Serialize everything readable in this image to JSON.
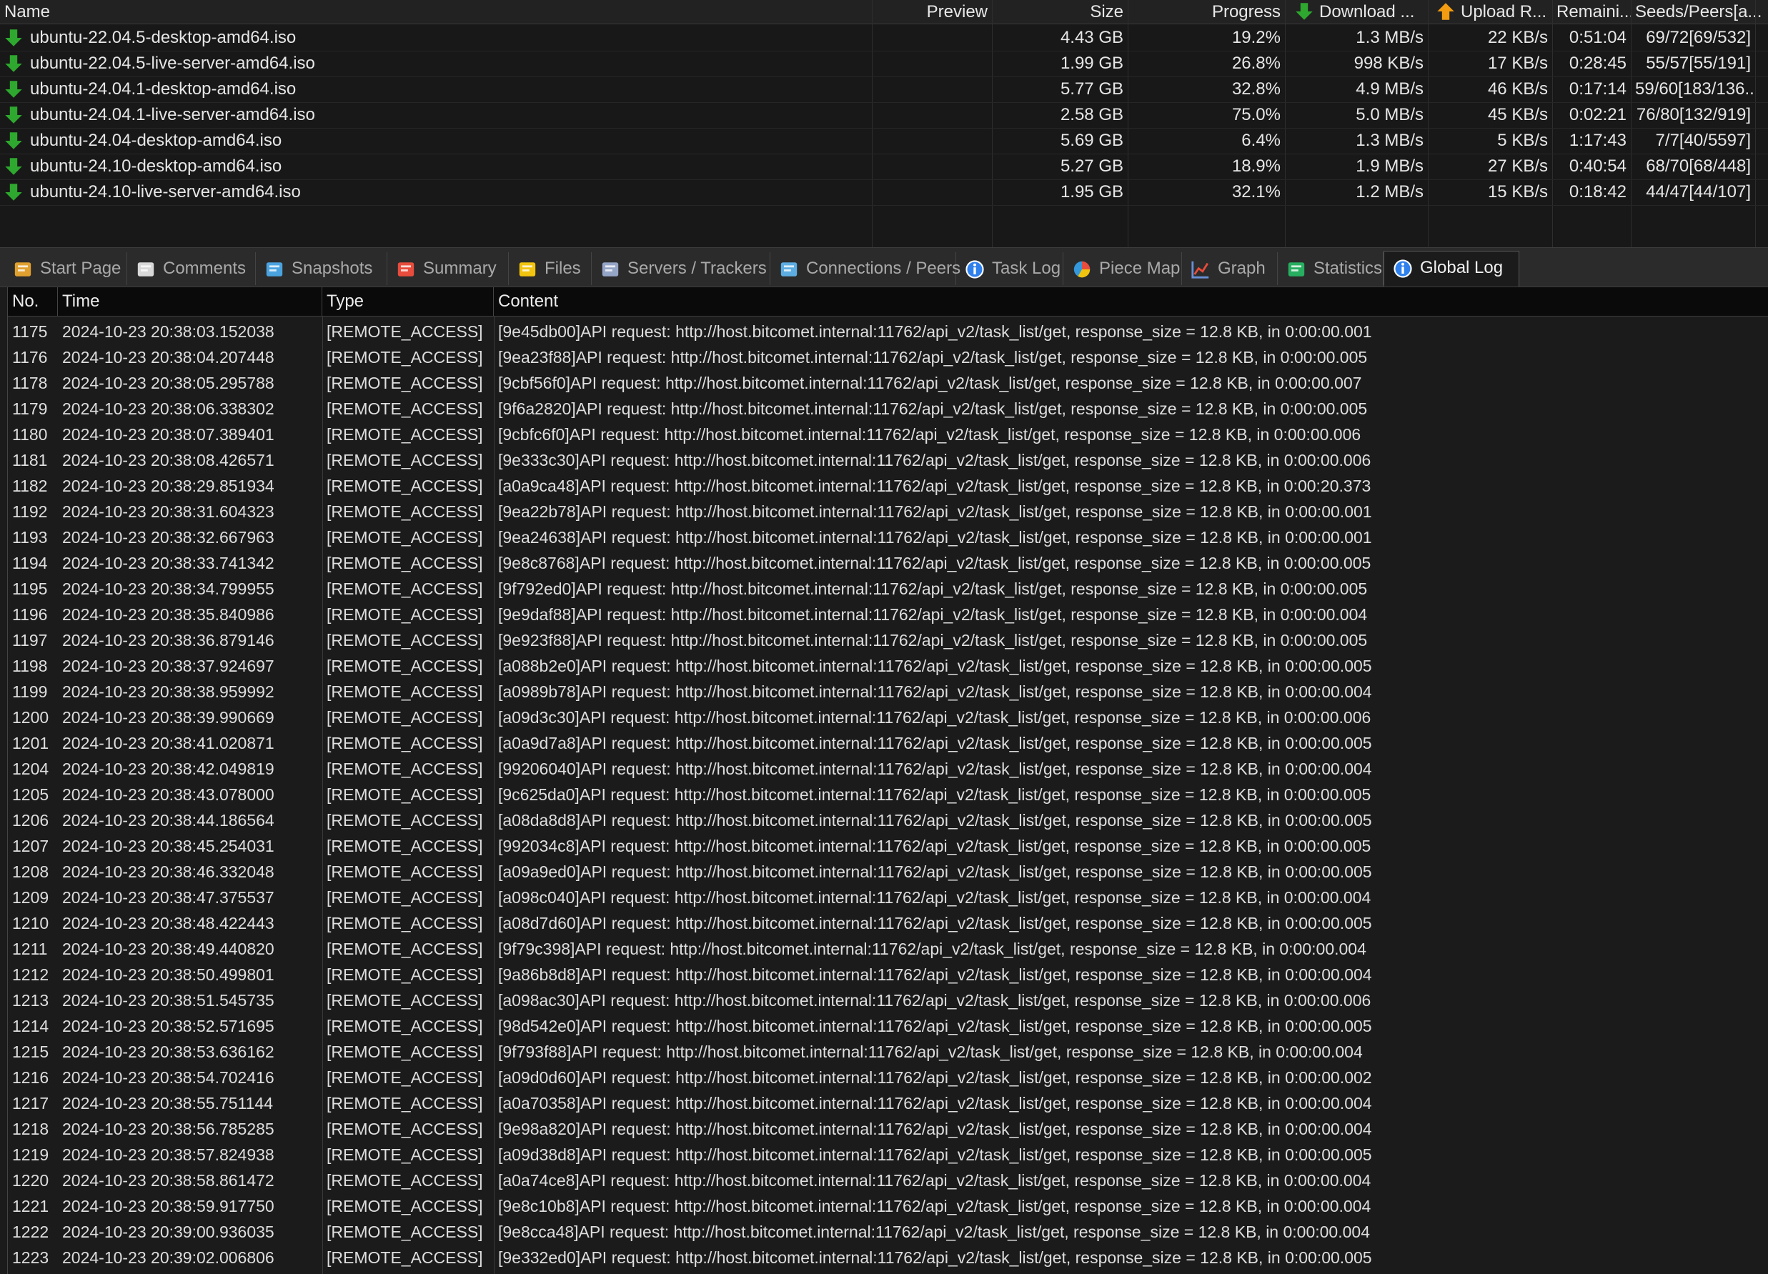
{
  "colors": {
    "accent_green": "#2ea82e",
    "upload_orange": "#f39c12",
    "bg": "#1b1b1b"
  },
  "tasks": {
    "columns": [
      "Name",
      "Preview",
      "Size",
      "Progress",
      "Download ...",
      "Upload R...",
      "Remaini...",
      "Seeds/Peers[a..."
    ],
    "rows": [
      {
        "name": "ubuntu-22.04.5-desktop-amd64.iso",
        "preview": "",
        "size": "4.43 GB",
        "progress": "19.2%",
        "download": "1.3 MB/s",
        "upload": "22 KB/s",
        "remaining": "0:51:04",
        "seeds": "69/72[69/532]"
      },
      {
        "name": "ubuntu-22.04.5-live-server-amd64.iso",
        "preview": "",
        "size": "1.99 GB",
        "progress": "26.8%",
        "download": "998 KB/s",
        "upload": "17 KB/s",
        "remaining": "0:28:45",
        "seeds": "55/57[55/191]"
      },
      {
        "name": "ubuntu-24.04.1-desktop-amd64.iso",
        "preview": "",
        "size": "5.77 GB",
        "progress": "32.8%",
        "download": "4.9 MB/s",
        "upload": "46 KB/s",
        "remaining": "0:17:14",
        "seeds": "59/60[183/136..."
      },
      {
        "name": "ubuntu-24.04.1-live-server-amd64.iso",
        "preview": "",
        "size": "2.58 GB",
        "progress": "75.0%",
        "download": "5.0 MB/s",
        "upload": "45 KB/s",
        "remaining": "0:02:21",
        "seeds": "76/80[132/919]"
      },
      {
        "name": "ubuntu-24.04-desktop-amd64.iso",
        "preview": "",
        "size": "5.69 GB",
        "progress": "6.4%",
        "download": "1.3 MB/s",
        "upload": "5 KB/s",
        "remaining": "1:17:43",
        "seeds": "7/7[40/5597]"
      },
      {
        "name": "ubuntu-24.10-desktop-amd64.iso",
        "preview": "",
        "size": "5.27 GB",
        "progress": "18.9%",
        "download": "1.9 MB/s",
        "upload": "27 KB/s",
        "remaining": "0:40:54",
        "seeds": "68/70[68/448]"
      },
      {
        "name": "ubuntu-24.10-live-server-amd64.iso",
        "preview": "",
        "size": "1.95 GB",
        "progress": "32.1%",
        "download": "1.2 MB/s",
        "upload": "15 KB/s",
        "remaining": "0:18:42",
        "seeds": "44/47[44/107]"
      }
    ]
  },
  "tabs": [
    {
      "label": "Start Page",
      "icon": "start-page-icon"
    },
    {
      "label": "Comments",
      "icon": "comments-icon"
    },
    {
      "label": "Snapshots",
      "icon": "snapshots-icon"
    },
    {
      "label": "Summary",
      "icon": "summary-icon"
    },
    {
      "label": "Files",
      "icon": "files-icon"
    },
    {
      "label": "Servers / Trackers",
      "icon": "servers-icon"
    },
    {
      "label": "Connections / Peers",
      "icon": "peers-icon"
    },
    {
      "label": "Task Log",
      "icon": "info-icon"
    },
    {
      "label": "Piece Map",
      "icon": "piece-map-icon"
    },
    {
      "label": "Graph",
      "icon": "graph-icon"
    },
    {
      "label": "Statistics",
      "icon": "statistics-icon"
    },
    {
      "label": "Global Log",
      "icon": "info-icon",
      "active": true
    }
  ],
  "log": {
    "columns": [
      "No.",
      "Time",
      "Type",
      "Content"
    ],
    "rows": [
      {
        "no": "1175",
        "time": "2024-10-23 20:38:03.152038",
        "type": "[REMOTE_ACCESS]",
        "content": "[9e45db00]API request: http://host.bitcomet.internal:11762/api_v2/task_list/get, response_size = 12.8 KB, in 0:00:00.001"
      },
      {
        "no": "1176",
        "time": "2024-10-23 20:38:04.207448",
        "type": "[REMOTE_ACCESS]",
        "content": "[9ea23f88]API request: http://host.bitcomet.internal:11762/api_v2/task_list/get, response_size = 12.8 KB, in 0:00:00.005"
      },
      {
        "no": "1178",
        "time": "2024-10-23 20:38:05.295788",
        "type": "[REMOTE_ACCESS]",
        "content": "[9cbf56f0]API request: http://host.bitcomet.internal:11762/api_v2/task_list/get, response_size = 12.8 KB, in 0:00:00.007"
      },
      {
        "no": "1179",
        "time": "2024-10-23 20:38:06.338302",
        "type": "[REMOTE_ACCESS]",
        "content": "[9f6a2820]API request: http://host.bitcomet.internal:11762/api_v2/task_list/get, response_size = 12.8 KB, in 0:00:00.005"
      },
      {
        "no": "1180",
        "time": "2024-10-23 20:38:07.389401",
        "type": "[REMOTE_ACCESS]",
        "content": "[9cbfc6f0]API request: http://host.bitcomet.internal:11762/api_v2/task_list/get, response_size = 12.8 KB, in 0:00:00.006"
      },
      {
        "no": "1181",
        "time": "2024-10-23 20:38:08.426571",
        "type": "[REMOTE_ACCESS]",
        "content": "[9e333c30]API request: http://host.bitcomet.internal:11762/api_v2/task_list/get, response_size = 12.8 KB, in 0:00:00.006"
      },
      {
        "no": "1182",
        "time": "2024-10-23 20:38:29.851934",
        "type": "[REMOTE_ACCESS]",
        "content": "[a0a9ca48]API request: http://host.bitcomet.internal:11762/api_v2/task_list/get, response_size = 12.8 KB, in 0:00:20.373"
      },
      {
        "no": "1192",
        "time": "2024-10-23 20:38:31.604323",
        "type": "[REMOTE_ACCESS]",
        "content": "[9ea22b78]API request: http://host.bitcomet.internal:11762/api_v2/task_list/get, response_size = 12.8 KB, in 0:00:00.001"
      },
      {
        "no": "1193",
        "time": "2024-10-23 20:38:32.667963",
        "type": "[REMOTE_ACCESS]",
        "content": "[9ea24638]API request: http://host.bitcomet.internal:11762/api_v2/task_list/get, response_size = 12.8 KB, in 0:00:00.001"
      },
      {
        "no": "1194",
        "time": "2024-10-23 20:38:33.741342",
        "type": "[REMOTE_ACCESS]",
        "content": "[9e8c8768]API request: http://host.bitcomet.internal:11762/api_v2/task_list/get, response_size = 12.8 KB, in 0:00:00.005"
      },
      {
        "no": "1195",
        "time": "2024-10-23 20:38:34.799955",
        "type": "[REMOTE_ACCESS]",
        "content": "[9f792ed0]API request: http://host.bitcomet.internal:11762/api_v2/task_list/get, response_size = 12.8 KB, in 0:00:00.005"
      },
      {
        "no": "1196",
        "time": "2024-10-23 20:38:35.840986",
        "type": "[REMOTE_ACCESS]",
        "content": "[9e9daf88]API request: http://host.bitcomet.internal:11762/api_v2/task_list/get, response_size = 12.8 KB, in 0:00:00.004"
      },
      {
        "no": "1197",
        "time": "2024-10-23 20:38:36.879146",
        "type": "[REMOTE_ACCESS]",
        "content": "[9e923f88]API request: http://host.bitcomet.internal:11762/api_v2/task_list/get, response_size = 12.8 KB, in 0:00:00.005"
      },
      {
        "no": "1198",
        "time": "2024-10-23 20:38:37.924697",
        "type": "[REMOTE_ACCESS]",
        "content": "[a088b2e0]API request: http://host.bitcomet.internal:11762/api_v2/task_list/get, response_size = 12.8 KB, in 0:00:00.005"
      },
      {
        "no": "1199",
        "time": "2024-10-23 20:38:38.959992",
        "type": "[REMOTE_ACCESS]",
        "content": "[a0989b78]API request: http://host.bitcomet.internal:11762/api_v2/task_list/get, response_size = 12.8 KB, in 0:00:00.004"
      },
      {
        "no": "1200",
        "time": "2024-10-23 20:38:39.990669",
        "type": "[REMOTE_ACCESS]",
        "content": "[a09d3c30]API request: http://host.bitcomet.internal:11762/api_v2/task_list/get, response_size = 12.8 KB, in 0:00:00.006"
      },
      {
        "no": "1201",
        "time": "2024-10-23 20:38:41.020871",
        "type": "[REMOTE_ACCESS]",
        "content": "[a0a9d7a8]API request: http://host.bitcomet.internal:11762/api_v2/task_list/get, response_size = 12.8 KB, in 0:00:00.005"
      },
      {
        "no": "1204",
        "time": "2024-10-23 20:38:42.049819",
        "type": "[REMOTE_ACCESS]",
        "content": "[99206040]API request: http://host.bitcomet.internal:11762/api_v2/task_list/get, response_size = 12.8 KB, in 0:00:00.004"
      },
      {
        "no": "1205",
        "time": "2024-10-23 20:38:43.078000",
        "type": "[REMOTE_ACCESS]",
        "content": "[9c625da0]API request: http://host.bitcomet.internal:11762/api_v2/task_list/get, response_size = 12.8 KB, in 0:00:00.005"
      },
      {
        "no": "1206",
        "time": "2024-10-23 20:38:44.186564",
        "type": "[REMOTE_ACCESS]",
        "content": "[a08da8d8]API request: http://host.bitcomet.internal:11762/api_v2/task_list/get, response_size = 12.8 KB, in 0:00:00.005"
      },
      {
        "no": "1207",
        "time": "2024-10-23 20:38:45.254031",
        "type": "[REMOTE_ACCESS]",
        "content": "[992034c8]API request: http://host.bitcomet.internal:11762/api_v2/task_list/get, response_size = 12.8 KB, in 0:00:00.005"
      },
      {
        "no": "1208",
        "time": "2024-10-23 20:38:46.332048",
        "type": "[REMOTE_ACCESS]",
        "content": "[a09a9ed0]API request: http://host.bitcomet.internal:11762/api_v2/task_list/get, response_size = 12.8 KB, in 0:00:00.005"
      },
      {
        "no": "1209",
        "time": "2024-10-23 20:38:47.375537",
        "type": "[REMOTE_ACCESS]",
        "content": "[a098c040]API request: http://host.bitcomet.internal:11762/api_v2/task_list/get, response_size = 12.8 KB, in 0:00:00.004"
      },
      {
        "no": "1210",
        "time": "2024-10-23 20:38:48.422443",
        "type": "[REMOTE_ACCESS]",
        "content": "[a08d7d60]API request: http://host.bitcomet.internal:11762/api_v2/task_list/get, response_size = 12.8 KB, in 0:00:00.005"
      },
      {
        "no": "1211",
        "time": "2024-10-23 20:38:49.440820",
        "type": "[REMOTE_ACCESS]",
        "content": "[9f79c398]API request: http://host.bitcomet.internal:11762/api_v2/task_list/get, response_size = 12.8 KB, in 0:00:00.004"
      },
      {
        "no": "1212",
        "time": "2024-10-23 20:38:50.499801",
        "type": "[REMOTE_ACCESS]",
        "content": "[9a86b8d8]API request: http://host.bitcomet.internal:11762/api_v2/task_list/get, response_size = 12.8 KB, in 0:00:00.004"
      },
      {
        "no": "1213",
        "time": "2024-10-23 20:38:51.545735",
        "type": "[REMOTE_ACCESS]",
        "content": "[a098ac30]API request: http://host.bitcomet.internal:11762/api_v2/task_list/get, response_size = 12.8 KB, in 0:00:00.006"
      },
      {
        "no": "1214",
        "time": "2024-10-23 20:38:52.571695",
        "type": "[REMOTE_ACCESS]",
        "content": "[98d542e0]API request: http://host.bitcomet.internal:11762/api_v2/task_list/get, response_size = 12.8 KB, in 0:00:00.005"
      },
      {
        "no": "1215",
        "time": "2024-10-23 20:38:53.636162",
        "type": "[REMOTE_ACCESS]",
        "content": "[9f793f88]API request: http://host.bitcomet.internal:11762/api_v2/task_list/get, response_size = 12.8 KB, in 0:00:00.004"
      },
      {
        "no": "1216",
        "time": "2024-10-23 20:38:54.702416",
        "type": "[REMOTE_ACCESS]",
        "content": "[a09d0d60]API request: http://host.bitcomet.internal:11762/api_v2/task_list/get, response_size = 12.8 KB, in 0:00:00.002"
      },
      {
        "no": "1217",
        "time": "2024-10-23 20:38:55.751144",
        "type": "[REMOTE_ACCESS]",
        "content": "[a0a70358]API request: http://host.bitcomet.internal:11762/api_v2/task_list/get, response_size = 12.8 KB, in 0:00:00.004"
      },
      {
        "no": "1218",
        "time": "2024-10-23 20:38:56.785285",
        "type": "[REMOTE_ACCESS]",
        "content": "[9e98a820]API request: http://host.bitcomet.internal:11762/api_v2/task_list/get, response_size = 12.8 KB, in 0:00:00.004"
      },
      {
        "no": "1219",
        "time": "2024-10-23 20:38:57.824938",
        "type": "[REMOTE_ACCESS]",
        "content": "[a09d38d8]API request: http://host.bitcomet.internal:11762/api_v2/task_list/get, response_size = 12.8 KB, in 0:00:00.005"
      },
      {
        "no": "1220",
        "time": "2024-10-23 20:38:58.861472",
        "type": "[REMOTE_ACCESS]",
        "content": "[a0a74ce8]API request: http://host.bitcomet.internal:11762/api_v2/task_list/get, response_size = 12.8 KB, in 0:00:00.004"
      },
      {
        "no": "1221",
        "time": "2024-10-23 20:38:59.917750",
        "type": "[REMOTE_ACCESS]",
        "content": "[9e8c10b8]API request: http://host.bitcomet.internal:11762/api_v2/task_list/get, response_size = 12.8 KB, in 0:00:00.004"
      },
      {
        "no": "1222",
        "time": "2024-10-23 20:39:00.936035",
        "type": "[REMOTE_ACCESS]",
        "content": "[9e8cca48]API request: http://host.bitcomet.internal:11762/api_v2/task_list/get, response_size = 12.8 KB, in 0:00:00.004"
      },
      {
        "no": "1223",
        "time": "2024-10-23 20:39:02.006806",
        "type": "[REMOTE_ACCESS]",
        "content": "[9e332ed0]API request: http://host.bitcomet.internal:11762/api_v2/task_list/get, response_size = 12.8 KB, in 0:00:00.005"
      }
    ]
  }
}
